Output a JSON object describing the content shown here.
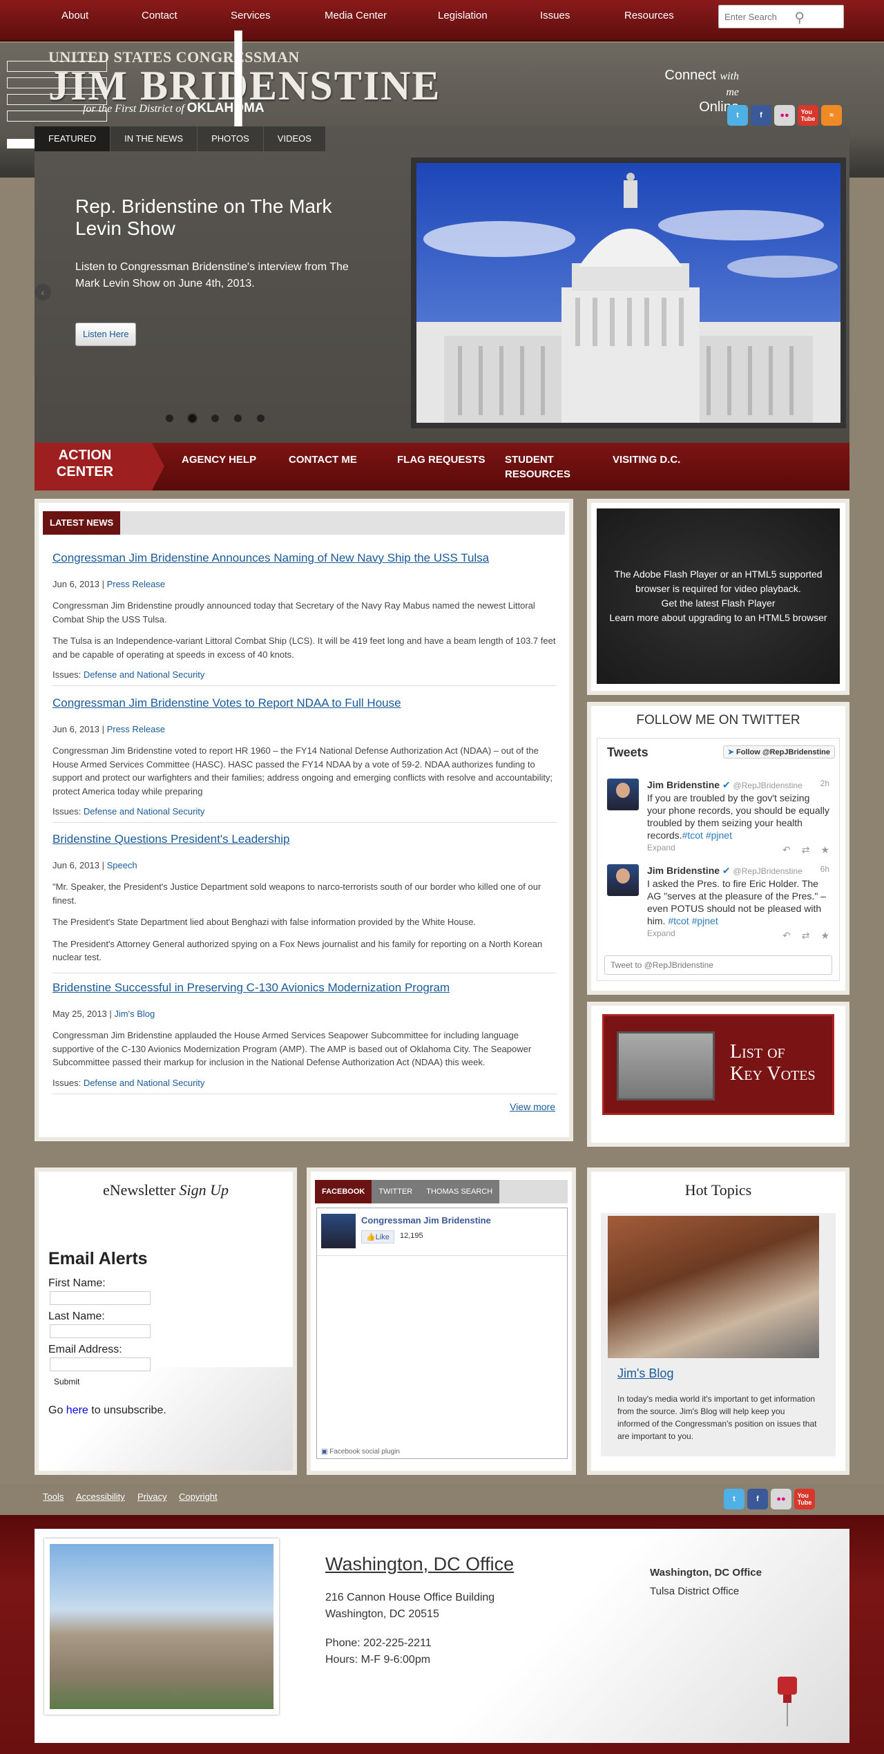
{
  "nav": {
    "items": [
      "About",
      "Contact",
      "Services",
      "Media Center",
      "Legislation",
      "Issues",
      "Resources"
    ],
    "search_placeholder": "Enter Search"
  },
  "header": {
    "top_line": "UNITED STATES CONGRESSMAN",
    "name": "JIM BRIDENSTINE",
    "subtitle_prefix": "for the First District of",
    "subtitle_state": "OKLAHOMA",
    "connect_line1": "Connect",
    "connect_with": "with me",
    "connect_line2": "Online"
  },
  "social_icons": [
    "twitter-icon",
    "facebook-icon",
    "flickr-icon",
    "youtube-icon",
    "rss-icon"
  ],
  "slider": {
    "tabs": [
      "FEATURED",
      "IN THE NEWS",
      "PHOTOS",
      "VIDEOS"
    ],
    "active_tab": 0,
    "title": "Rep. Bridenstine on The Mark Levin Show",
    "text": "Listen to Congressman Bridenstine's interview from The Mark Levin Show on June 4th, 2013.",
    "button": "Listen Here",
    "dot_count": 5,
    "active_dot": 1
  },
  "action_center": {
    "badge": "ACTION CENTER",
    "links": [
      "AGENCY HELP",
      "CONTACT ME",
      "FLAG REQUESTS",
      "STUDENT RESOURCES",
      "VISITING D.C."
    ]
  },
  "news": {
    "heading": "LATEST NEWS",
    "items": [
      {
        "title": "Congressman Jim Bridenstine Announces Naming of New Navy Ship the USS Tulsa",
        "date": "Jun 6, 2013",
        "category": "Press Release",
        "p1": "Congressman Jim Bridenstine proudly announced today that Secretary of the Navy Ray Mabus named the newest Littoral Combat Ship the USS Tulsa.",
        "p2": "The Tulsa is an Independence-variant Littoral Combat Ship (LCS).  It will be 419 feet long and have a beam length of 103.7 feet and be capable of operating at speeds in excess of 40 knots.",
        "issues_label": "Issues:",
        "issues": "Defense and National Security"
      },
      {
        "title": "Congressman Jim Bridenstine Votes to Report NDAA to Full House",
        "date": "Jun 6, 2013",
        "category": "Press Release",
        "p1": "Congressman Jim Bridenstine voted to report HR 1960 – the FY14 National Defense Authorization Act (NDAA) – out of the House Armed Services Committee (HASC).  HASC passed the FY14 NDAA by a vote of 59-2.  NDAA authorizes funding to support and protect our warfighters and their families; address ongoing and emerging conflicts with resolve and accountability; protect America today while preparing",
        "issues_label": "Issues:",
        "issues": "Defense and National Security"
      },
      {
        "title": "Bridenstine Questions President's Leadership",
        "date": "Jun 6, 2013",
        "category": "Speech",
        "p1": "\"Mr. Speaker, the President's Justice Department sold weapons to narco-terrorists south of our border who killed one of our finest.",
        "p2": "The President's State Department lied about Benghazi with false information provided by the White House.",
        "p3": "The President's Attorney General authorized spying on a Fox News journalist and his family for reporting on a North Korean nuclear test."
      },
      {
        "title": "Bridenstine Successful in Preserving C-130 Avionics Modernization Program",
        "date": "May 25, 2013",
        "category": "Jim's Blog",
        "p1": "Congressman Jim Bridenstine applauded the House Armed Services Seapower Subcommittee for including language supportive of the C-130 Avionics Modernization Program (AMP).  The AMP is based out of Oklahoma City.  The Seapower Subcommittee passed their markup for inclusion in the National Defense Authorization Act (NDAA) this week.",
        "issues_label": "Issues:",
        "issues": "Defense and National Security"
      }
    ],
    "view_more": "View more"
  },
  "video": {
    "line1": "The Adobe Flash Player or an HTML5 supported browser is required for video playback.",
    "link1": "Get the latest Flash Player",
    "link2": "Learn more about upgrading to an HTML5 browser"
  },
  "twitter": {
    "heading": "FOLLOW ME ON TWITTER",
    "label": "Tweets",
    "follow": "Follow @RepJBridenstine",
    "tweets": [
      {
        "name": "Jim Bridenstine",
        "handle": "@RepJBridenstine",
        "time": "2h",
        "text": "If you are troubled by the gov't seizing your phone records, you should be equally troubled by them seizing your health records.",
        "tags": "#tcot #pjnet",
        "expand": "Expand"
      },
      {
        "name": "Jim Bridenstine",
        "handle": "@RepJBridenstine",
        "time": "6h",
        "text": "I asked the Pres. to fire Eric Holder. The AG \"serves at the pleasure of the Pres.\" –even POTUS should not be pleased with him.",
        "tags": "#tcot #pjnet",
        "expand": "Expand"
      }
    ],
    "input_placeholder": "Tweet to @RepJBridenstine"
  },
  "key_votes": {
    "line1": "List of",
    "line2": "Key Votes"
  },
  "newsletter": {
    "heading": "eNewsletter",
    "heading_italic": "Sign Up",
    "title": "Email Alerts",
    "first_name": "First Name:",
    "last_name": "Last Name:",
    "email": "Email Address:",
    "submit": "Submit",
    "unsub_pre": "Go",
    "unsub_link": "here",
    "unsub_post": "to unsubscribe."
  },
  "social_feed": {
    "tabs": [
      "FACEBOOK",
      "TWITTER",
      "THOMAS SEARCH"
    ],
    "page_name": "Congressman Jim Bridenstine",
    "like": "Like",
    "like_count": "12,195",
    "footer": "Facebook social plugin"
  },
  "hot_topics": {
    "heading": "Hot Topics",
    "link": "Jim's Blog",
    "text": "In today's media world it's important to get information from the source. Jim's Blog will help keep you informed of the Congressman's position on issues that are important to you."
  },
  "footer_links": [
    "Tools",
    "Accessibility",
    "Privacy",
    "Copyright"
  ],
  "office": {
    "title": "Washington, DC Office",
    "address1": "216 Cannon House Office Building",
    "address2": "Washington, DC 20515",
    "phone": "Phone: 202-225-2211",
    "hours": "Hours: M-F 9-6:00pm",
    "offices": [
      "Washington, DC Office",
      "Tulsa District Office"
    ]
  }
}
